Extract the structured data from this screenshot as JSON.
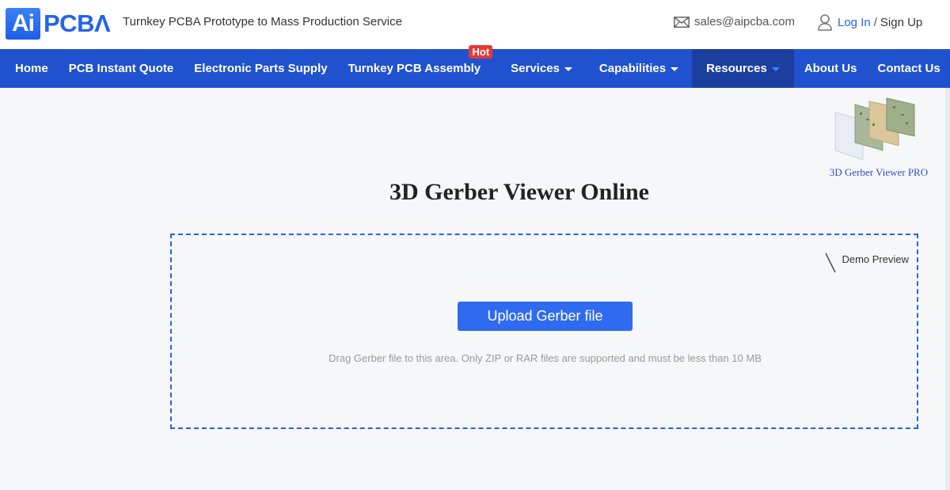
{
  "header": {
    "logo_ai": "Ai",
    "logo_pcba": "PCBΛ",
    "tagline": "Turnkey PCBA Prototype to Mass Production Service",
    "email": "sales@aipcba.com",
    "login": "Log In",
    "separator": "/",
    "signup": "Sign Up",
    "icons": {
      "email": "envelope-icon",
      "account": "user-icon"
    }
  },
  "nav": {
    "items": [
      {
        "label": "Home"
      },
      {
        "label": "PCB Instant Quote"
      },
      {
        "label": "Electronic Parts Supply"
      },
      {
        "label": "Turnkey PCB Assembly",
        "badge": "Hot"
      },
      {
        "label": "Services",
        "dropdown": true
      },
      {
        "label": "Capabilities",
        "dropdown": true
      },
      {
        "label": "Resources",
        "dropdown": true,
        "active": true
      },
      {
        "label": "About Us"
      },
      {
        "label": "Contact Us"
      }
    ],
    "colors": {
      "background": "#2052cf",
      "active": "#1b3f9e",
      "badge": "#e53935"
    }
  },
  "promo": {
    "label": "3D Gerber Viewer PRO"
  },
  "main": {
    "title": "3D Gerber Viewer Online",
    "demo_label": "Demo Preview",
    "upload_button": "Upload Gerber file",
    "hint": "Drag Gerber file to this area. Only ZIP or RAR files are supported and must be less than 10 MB",
    "accent": "#2f6bf0"
  }
}
